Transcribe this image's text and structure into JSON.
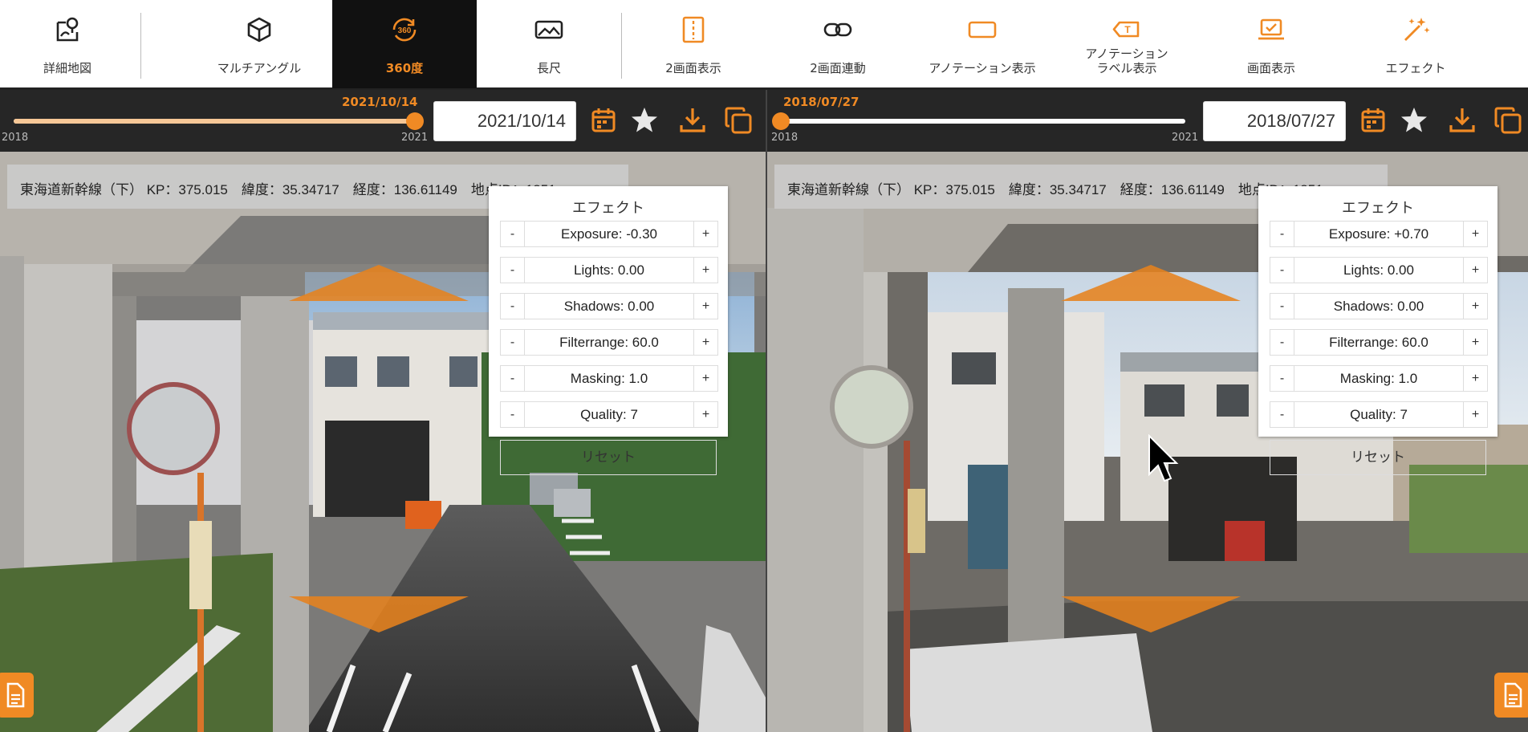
{
  "toolbar": {
    "items": [
      {
        "label": "詳細地図",
        "icon": "map-pin-icon"
      },
      {
        "label": "マルチアングル",
        "icon": "cube-icon"
      },
      {
        "label": "360度",
        "icon": "rotate-360-icon",
        "active": true
      },
      {
        "label": "長尺",
        "icon": "panorama-icon"
      },
      {
        "label": "2画面表示",
        "icon": "split-screen-icon"
      },
      {
        "label": "2画面連動",
        "icon": "link-icon"
      },
      {
        "label": "アノテーション表示",
        "icon": "annotation-frame-icon"
      },
      {
        "label1": "アノテーション",
        "label2": "ラベル表示",
        "icon": "label-tag-icon"
      },
      {
        "label": "画面表示",
        "icon": "laptop-check-icon"
      },
      {
        "label": "エフェクト",
        "icon": "magic-wand-icon"
      }
    ]
  },
  "colors": {
    "accent": "#f08a24",
    "bar": "#262626",
    "active_bg": "#111111"
  },
  "left": {
    "slider": {
      "min_label": "2018",
      "max_label": "2021",
      "position": 1.0,
      "knob_label": "2021/10/14"
    },
    "date_value": "2021/10/14",
    "info": "東海道新幹線（下） KP：375.015　緯度：35.34717　経度：136.61149　地点ID：1851",
    "effect": {
      "title": "エフェクト",
      "rows": [
        "Exposure: -0.30",
        "Lights: 0.00",
        "Shadows: 0.00",
        "Filterrange: 60.0",
        "Masking: 1.0",
        "Quality: 7"
      ],
      "minus": "-",
      "plus": "+",
      "reset": "リセット"
    }
  },
  "right": {
    "slider": {
      "min_label": "2018",
      "max_label": "2021",
      "position": 0.0,
      "knob_label": "2018/07/27"
    },
    "date_value": "2018/07/27",
    "info": "東海道新幹線（下） KP：375.015　緯度：35.34717　経度：136.61149　地点ID：1851",
    "effect": {
      "title": "エフェクト",
      "rows": [
        "Exposure: +0.70",
        "Lights: 0.00",
        "Shadows: 0.00",
        "Filterrange: 60.0",
        "Masking: 1.0",
        "Quality: 7"
      ],
      "minus": "-",
      "plus": "+",
      "reset": "リセット"
    }
  }
}
